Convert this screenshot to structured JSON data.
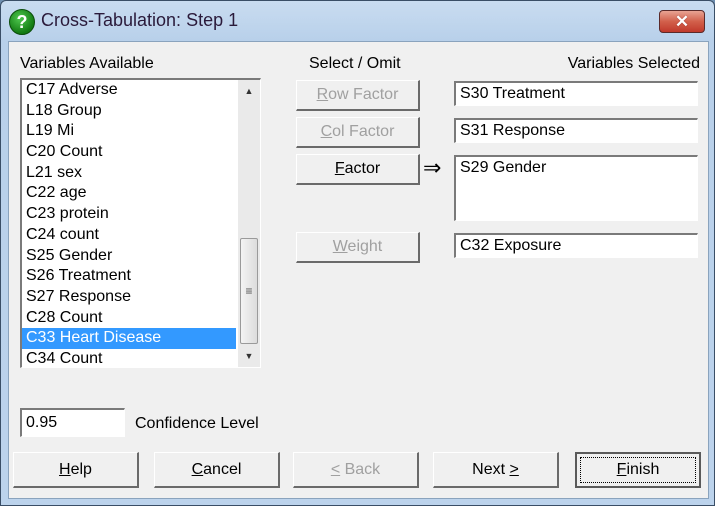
{
  "window": {
    "title": "Cross-Tabulation: Step 1",
    "title_icon": "help-question-icon",
    "close_label": "✕"
  },
  "variables_available": {
    "label": "Variables Available",
    "items": [
      {
        "label": "C17 Adverse",
        "selected": false
      },
      {
        "label": "L18 Group",
        "selected": false
      },
      {
        "label": "L19 Mi",
        "selected": false
      },
      {
        "label": "C20 Count",
        "selected": false
      },
      {
        "label": "L21 sex",
        "selected": false
      },
      {
        "label": "C22 age",
        "selected": false
      },
      {
        "label": "C23 protein",
        "selected": false
      },
      {
        "label": "C24 count",
        "selected": false
      },
      {
        "label": "S25 Gender",
        "selected": false
      },
      {
        "label": "S26 Treatment",
        "selected": false
      },
      {
        "label": "S27 Response",
        "selected": false
      },
      {
        "label": "C28 Count",
        "selected": false
      },
      {
        "label": "C33 Heart Disease",
        "selected": true
      },
      {
        "label": "C34 Count",
        "selected": false
      }
    ]
  },
  "select_omit": {
    "label": "Select / Omit",
    "row_factor": {
      "accel": "R",
      "rest": "ow Factor",
      "enabled": false
    },
    "col_factor": {
      "accel": "C",
      "rest": "ol Factor",
      "enabled": false
    },
    "factor": {
      "accel": "F",
      "rest": "actor",
      "enabled": true
    },
    "weight": {
      "accel": "W",
      "rest": "eight",
      "enabled": false
    },
    "arrow": "⇒"
  },
  "variables_selected": {
    "label": "Variables Selected",
    "row_factor_value": "S30 Treatment",
    "col_factor_value": "S31 Response",
    "factor_value": "S29 Gender",
    "weight_value": "C32 Exposure"
  },
  "confidence": {
    "value": "0.95",
    "label": "Confidence Level"
  },
  "footer": {
    "help": {
      "accel": "H",
      "rest": "elp"
    },
    "cancel": {
      "accel": "C",
      "rest": "ancel"
    },
    "back": {
      "accel": "<",
      "rest": " Back",
      "enabled": false
    },
    "next": {
      "pre": "Next ",
      "accel": ">"
    },
    "finish": {
      "accel": "F",
      "rest": "inish"
    }
  }
}
